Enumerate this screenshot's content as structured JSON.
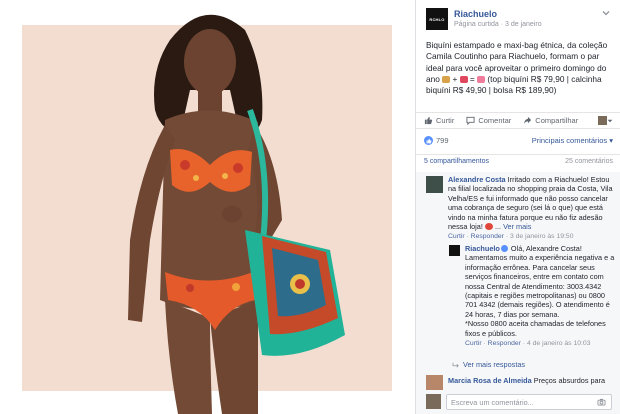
{
  "page": {
    "name": "Riachuelo",
    "meta_type": "Página curtida",
    "meta_sep": " · ",
    "meta_date": "3 de janeiro",
    "logo_text": "RCHLO"
  },
  "post": {
    "text_part1": "Biquíni estampado e maxi-bag étnica, da coleção Camila Coutinho para Riachuelo, formam o par ideal para você aproveitar o primeiro domingo do ano ",
    "text_part2": " + ",
    "text_part3": " = ",
    "text_part4": " (top biquíni R$ 79,90 | calcinha biquíni R$ 49,90 | bolsa R$ 189,90)"
  },
  "actions": {
    "like": "Curtir",
    "comment": "Comentar",
    "share": "Compartilhar"
  },
  "stats": {
    "likes": "799",
    "top_comments": "Principais comentários"
  },
  "counts": {
    "shares": "5 compartilhamentos",
    "comments": "25 comentários"
  },
  "comments": [
    {
      "author": "Alexandre Costa",
      "text": " Irritado com a Riachuelo! Estou na filial localizada no shopping praia da Costa, Vila Velha/ES e fui informado que não posso cancelar uma cobrança de seguro (sei lá o que) que está vindo na minha fatura porque eu não fiz adesão nessa loja! ",
      "see_more": "Ver mais",
      "like": "Curtir",
      "reply": "Responder",
      "date": "3 de janeiro às 19:50"
    }
  ],
  "reply": {
    "author": "Riachuelo",
    "text": " Olá, Alexandre Costa! Lamentamos muito a experiência negativa e a informação errônea. Para cancelar seus serviços financeiros, entre em contato com nossa Central de Atendimento: 3003.4342 (capitais e regiões metropolitanas) ou 0800 701 4342 (demais regiões). O atendimento é 24 horas, 7 dias por semana.",
    "note": "*Nosso 0800 aceita chamadas de telefones fixos e públicos.",
    "like": "Curtir",
    "reply": "Responder",
    "date": "4 de janeiro às 10:03"
  },
  "more_replies": "Ver mais respostas",
  "next_comment": {
    "author": "Marcia Rosa de Almeida",
    "text": " Preços absurdos para"
  },
  "composer": {
    "placeholder": "Escreva um comentário..."
  },
  "colors": {
    "link": "#365899",
    "like_badge": "#5890ff",
    "muted": "#90949c"
  }
}
